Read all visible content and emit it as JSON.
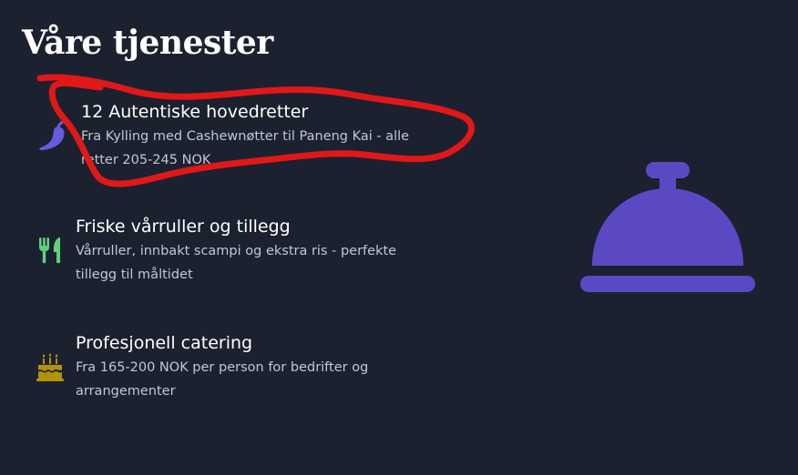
{
  "section": {
    "title": "Våre tjenester"
  },
  "services": [
    {
      "icon": "chili-pepper-icon",
      "title": "12 Autentiske hovedretter",
      "description": "Fra Kylling med Cashewnøtter til Paneng Kai - alle retter 205-245 NOK"
    },
    {
      "icon": "fork-knife-icon",
      "title": "Friske vårruller og tillegg",
      "description": "Vårruller, innbakt scampi og ekstra ris - perfekte tillegg til måltidet"
    },
    {
      "icon": "birthday-cake-icon",
      "title": "Profesjonell catering",
      "description": "Fra 165-200 NOK per person for bedrifter og arrangementer"
    }
  ],
  "illustration": {
    "icon": "concierge-bell-icon"
  },
  "colors": {
    "background": "#1c2130",
    "accent_purple": "#5b49c4",
    "pepper": "#6a5ae0",
    "utensils": "#5fd17e",
    "cake": "#b0930a",
    "annotation_red": "#e01818"
  }
}
